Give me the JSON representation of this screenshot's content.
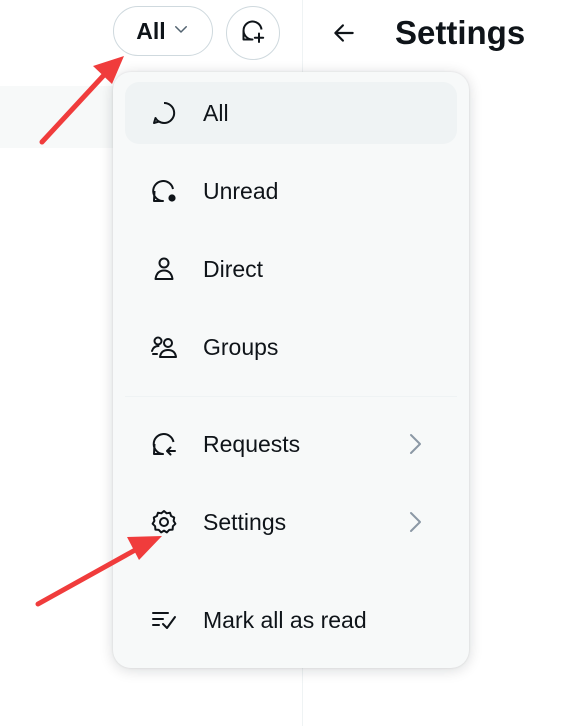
{
  "header": {
    "filter_label": "All",
    "page_title": "Settings"
  },
  "menu": {
    "items": [
      {
        "label": "All",
        "icon": "message-icon"
      },
      {
        "label": "Unread",
        "icon": "unread-message-icon"
      },
      {
        "label": "Direct",
        "icon": "person-icon"
      },
      {
        "label": "Groups",
        "icon": "people-icon"
      },
      {
        "label": "Requests",
        "icon": "requests-icon"
      },
      {
        "label": "Settings",
        "icon": "gear-icon"
      },
      {
        "label": "Mark all as read",
        "icon": "mark-read-icon"
      }
    ]
  },
  "colors": {
    "text": "#0f1419",
    "menu_background": "#f7f9f9",
    "chevron": "#8b98a5",
    "annotation_arrow": "#f03c3c"
  }
}
